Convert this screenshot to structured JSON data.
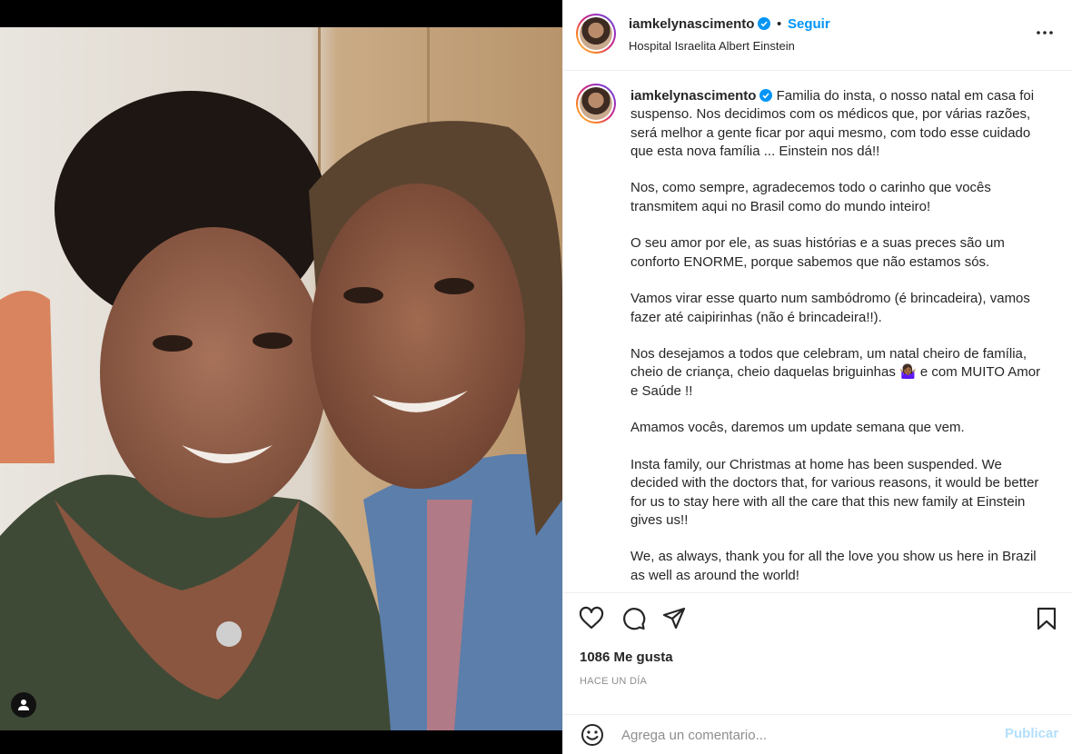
{
  "post": {
    "username": "iamkelynascimento",
    "separator": "•",
    "follow_label": "Seguir",
    "location": "Hospital Israelita Albert Einstein",
    "more_icon": "more-horizontal-icon",
    "verified_icon": "verified-badge-icon"
  },
  "caption": {
    "username": "iamkelynascimento",
    "first_line": "Familia do insta, o nosso natal em casa foi suspenso. Nos decidimos com os médicos que, por várias razões, será melhor a gente ficar por aqui mesmo, com todo esse cuidado que esta nova família ... Einstein nos dá!!",
    "paragraphs": [
      "Nos, como sempre, agradecemos todo o carinho que vocês transmitem aqui no Brasil como do mundo inteiro!",
      "O seu amor por ele, as suas histórias e a suas preces são um conforto ENORME, porque sabemos que não estamos sós.",
      "Vamos virar esse quarto num sambódromo (é brincadeira), vamos fazer até caipirinhas (não é brincadeira!!).",
      "Nos desejamos a todos que celebram, um natal cheiro de família, cheio de criança, cheio daquelas briguinhas 🤷🏾‍♀️ e com MUITO Amor e Saúde !!",
      "Amamos vocês, daremos um update semana que vem.",
      "Insta family, our Christmas at home has been suspended. We decided with the doctors that, for various reasons, it would be better for us to stay here with all the care that this new family at Einstein gives us!!",
      "We, as always, thank you for all the love you show us here in Brazil as well as around the world!"
    ]
  },
  "actions": {
    "icons": [
      "heart-icon",
      "comment-icon",
      "share-icon",
      "bookmark-icon"
    ],
    "likes": "1086 Me gusta",
    "timestamp": "HACE UN DÍA"
  },
  "comment_box": {
    "emoji_icon": "emoji-icon",
    "placeholder": "Agrega un comentario...",
    "publish_label": "Publicar"
  },
  "media": {
    "user_tag_icon": "user-tag-icon"
  },
  "colors": {
    "accent": "#0095f6",
    "publish_disabled": "#b2dffc",
    "secondary_text": "#8e8e8e"
  }
}
